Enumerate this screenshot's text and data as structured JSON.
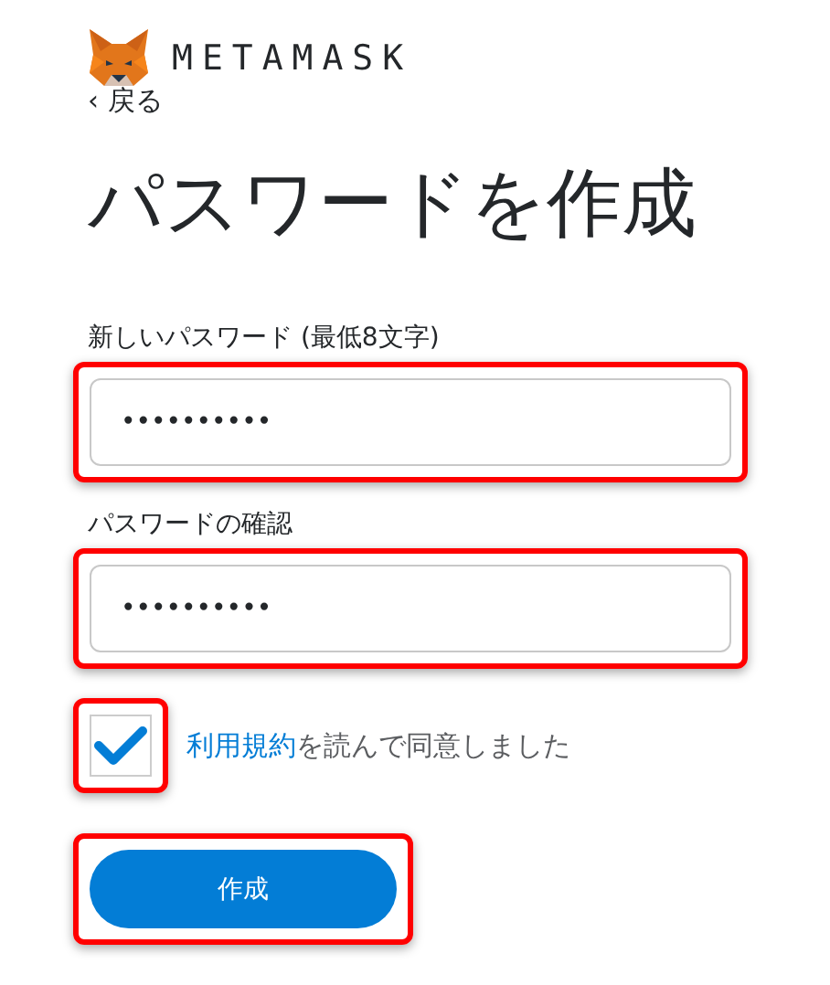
{
  "header": {
    "brand": "METAMASK",
    "back_link": "‹ 戻る"
  },
  "title": "パスワードを作成",
  "fields": [
    {
      "label": "新しいパスワード (最低8文字)",
      "value": "••••••••••",
      "highlighted": true
    },
    {
      "label": "パスワードの確認",
      "value": "••••••••••",
      "highlighted": true
    }
  ],
  "terms": {
    "checked": true,
    "highlighted": true,
    "link": "利用規約",
    "text": "を読んで同意しました"
  },
  "submit_button": {
    "label": "作成",
    "highlighted": true
  }
}
